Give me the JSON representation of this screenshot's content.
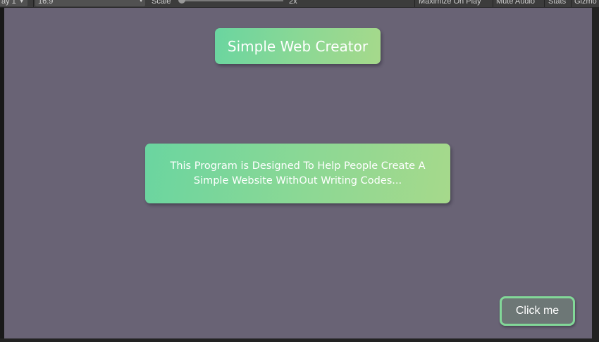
{
  "editor_toolbar": {
    "display_dropdown": "ay 1",
    "aspect_dropdown": "16:9",
    "scale_label": "Scale",
    "scale_value": "2x",
    "maximize_on_play": "Maximize On Play",
    "mute_audio": "Mute Audio",
    "stats": "Stats",
    "gizmos": "Gizmo"
  },
  "game": {
    "title": "Simple Web Creator",
    "description": "This Program is Designed To Help People Create A Simple Website WithOut Writing Codes...",
    "click_button_label": "Click me"
  },
  "colors": {
    "background": "#696375",
    "panel_gradient_start": "#6ad5a0",
    "panel_gradient_end": "#a6d98b",
    "button_fill": "#6d7776",
    "button_border": "#82d898"
  }
}
